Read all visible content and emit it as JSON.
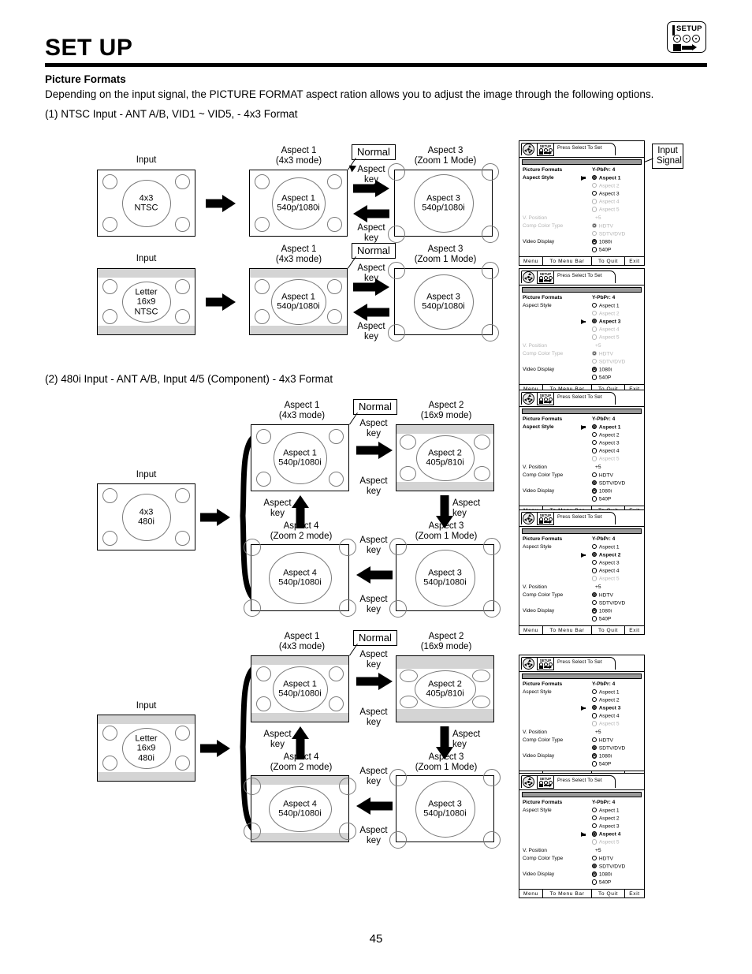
{
  "header": {
    "title": "SET UP",
    "badge": {
      "label": "SETUP",
      "icon": "setup-remote-icon"
    }
  },
  "intro": {
    "heading": "Picture Formats",
    "paragraph": "Depending on the input signal, the PICTURE FORMAT aspect ration allows you to adjust the image through the following options.",
    "section1": "(1)  NTSC Input - ANT A/B, VID1 ~ VID5, - 4x3 Format",
    "section2": "(2)  480i Input - ANT A/B, Input 4/5 (Component) - 4x3 Format"
  },
  "labels": {
    "input": "Input",
    "normal": "Normal",
    "aspect_key": "Aspect\nkey",
    "aspect_key_l1": "Aspect",
    "aspect_key_l2": "key",
    "input_signal_l1": "Input",
    "input_signal_l2": "Signal"
  },
  "boxes": {
    "ntsc_4x3": {
      "title": "Input",
      "lines": [
        "4x3",
        "NTSC"
      ]
    },
    "ntsc_letter": {
      "title": "Input",
      "lines": [
        "Letter",
        "16x9",
        "NTSC"
      ]
    },
    "i480_4x3": {
      "title": "Input",
      "lines": [
        "4x3",
        "480i"
      ]
    },
    "i480_letter": {
      "title": "Input",
      "lines": [
        "Letter",
        "16x9",
        "480i"
      ]
    },
    "aspect1": {
      "title_l1": "Aspect 1",
      "title_l2": "(4x3 mode)",
      "lines": [
        "Aspect 1",
        "540p/1080i"
      ]
    },
    "aspect2": {
      "title_l1": "Aspect 2",
      "title_l2": "(16x9 mode)",
      "lines": [
        "Aspect 2",
        "405p/810i"
      ]
    },
    "aspect3": {
      "title_l1": "Aspect 3",
      "title_l2": "(Zoom 1 Mode)",
      "lines": [
        "Aspect 3",
        "540p/1080i"
      ]
    },
    "aspect4": {
      "title_l1": "Aspect 4",
      "title_l2": "(Zoom 2 mode)",
      "lines": [
        "Aspect 4",
        "540p/1080i"
      ]
    }
  },
  "osd": {
    "press_select": "Press Select To Set",
    "icon_label": "SETUP",
    "title": "Picture Formats",
    "signal": "Y-PbPr: 4",
    "aspect_style_label": "Aspect Style",
    "aspect_options": [
      "Aspect 1",
      "Aspect 2",
      "Aspect 3",
      "Aspect 4",
      "Aspect 5"
    ],
    "v_position_label": "V. Position",
    "v_position_value": "+5",
    "comp_color_label": "Comp Color Type",
    "comp_color_options": [
      "HDTV",
      "SDTV/DVD"
    ],
    "video_display_label": "Video Display",
    "video_display_options": [
      "1080i",
      "540P"
    ],
    "footer": [
      "Menu",
      "To Menu Bar",
      "To Quit",
      "Exit"
    ]
  },
  "osd_states": [
    {
      "id": "osd-1",
      "selected_aspect": 0,
      "cursor_aspect": 0,
      "enabled_aspects": [
        true,
        false,
        true,
        false,
        false
      ],
      "comp_selected": 0,
      "comp_enabled": [
        false,
        false
      ],
      "video_selected": 0,
      "v_position_enabled": false,
      "comp_label_enabled": false
    },
    {
      "id": "osd-2",
      "selected_aspect": 2,
      "cursor_aspect": 2,
      "enabled_aspects": [
        true,
        false,
        true,
        false,
        false
      ],
      "comp_selected": 0,
      "comp_enabled": [
        false,
        false
      ],
      "video_selected": 0,
      "v_position_enabled": false,
      "comp_label_enabled": false
    },
    {
      "id": "osd-3",
      "selected_aspect": 0,
      "cursor_aspect": 0,
      "enabled_aspects": [
        true,
        true,
        true,
        true,
        false
      ],
      "comp_selected": 1,
      "comp_enabled": [
        true,
        true
      ],
      "video_selected": 0,
      "v_position_enabled": true,
      "comp_label_enabled": true
    },
    {
      "id": "osd-4",
      "selected_aspect": 1,
      "cursor_aspect": 1,
      "enabled_aspects": [
        true,
        true,
        true,
        true,
        false
      ],
      "comp_selected": 0,
      "comp_enabled": [
        true,
        true
      ],
      "video_selected": 0,
      "v_position_enabled": true,
      "comp_label_enabled": true
    },
    {
      "id": "osd-5",
      "selected_aspect": 2,
      "cursor_aspect": 2,
      "enabled_aspects": [
        true,
        true,
        true,
        true,
        false
      ],
      "comp_selected": 1,
      "comp_enabled": [
        true,
        true
      ],
      "video_selected": 0,
      "v_position_enabled": true,
      "comp_label_enabled": true
    },
    {
      "id": "osd-6",
      "selected_aspect": 3,
      "cursor_aspect": 3,
      "enabled_aspects": [
        true,
        true,
        true,
        true,
        false
      ],
      "comp_selected": 1,
      "comp_enabled": [
        true,
        true
      ],
      "video_selected": 0,
      "v_position_enabled": true,
      "comp_label_enabled": true
    }
  ],
  "footer": {
    "page_number": "45"
  }
}
